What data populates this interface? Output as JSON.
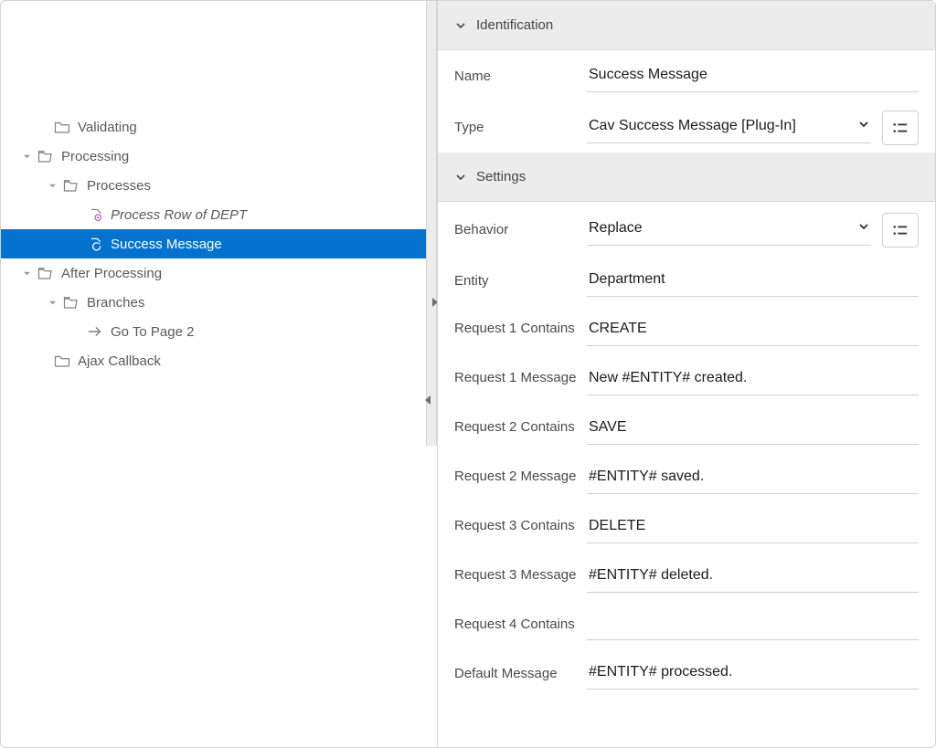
{
  "tree": {
    "validating": {
      "label": "Validating"
    },
    "processing": {
      "label": "Processing"
    },
    "processes": {
      "label": "Processes"
    },
    "process_row_dept": {
      "label": "Process Row of DEPT"
    },
    "success_message": {
      "label": "Success Message"
    },
    "after_processing": {
      "label": "After Processing"
    },
    "branches": {
      "label": "Branches"
    },
    "goto_page2": {
      "label": "Go To Page 2"
    },
    "ajax_callback": {
      "label": "Ajax Callback"
    }
  },
  "panel": {
    "section_identification": "Identification",
    "section_settings": "Settings",
    "fields": {
      "name": {
        "label": "Name",
        "value": "Success Message"
      },
      "type": {
        "label": "Type",
        "value": "Cav Success Message [Plug-In]"
      },
      "behavior": {
        "label": "Behavior",
        "value": "Replace"
      },
      "entity": {
        "label": "Entity",
        "value": "Department"
      },
      "req1_contains": {
        "label": "Request 1 Contains",
        "value": "CREATE"
      },
      "req1_message": {
        "label": "Request 1 Message",
        "value": "New #ENTITY# created."
      },
      "req2_contains": {
        "label": "Request 2 Contains",
        "value": "SAVE"
      },
      "req2_message": {
        "label": "Request 2 Message",
        "value": "#ENTITY# saved."
      },
      "req3_contains": {
        "label": "Request 3 Contains",
        "value": "DELETE"
      },
      "req3_message": {
        "label": "Request 3 Message",
        "value": "#ENTITY# deleted."
      },
      "req4_contains": {
        "label": "Request 4 Contains",
        "value": ""
      },
      "default_message": {
        "label": "Default Message",
        "value": "#ENTITY# processed."
      }
    }
  }
}
